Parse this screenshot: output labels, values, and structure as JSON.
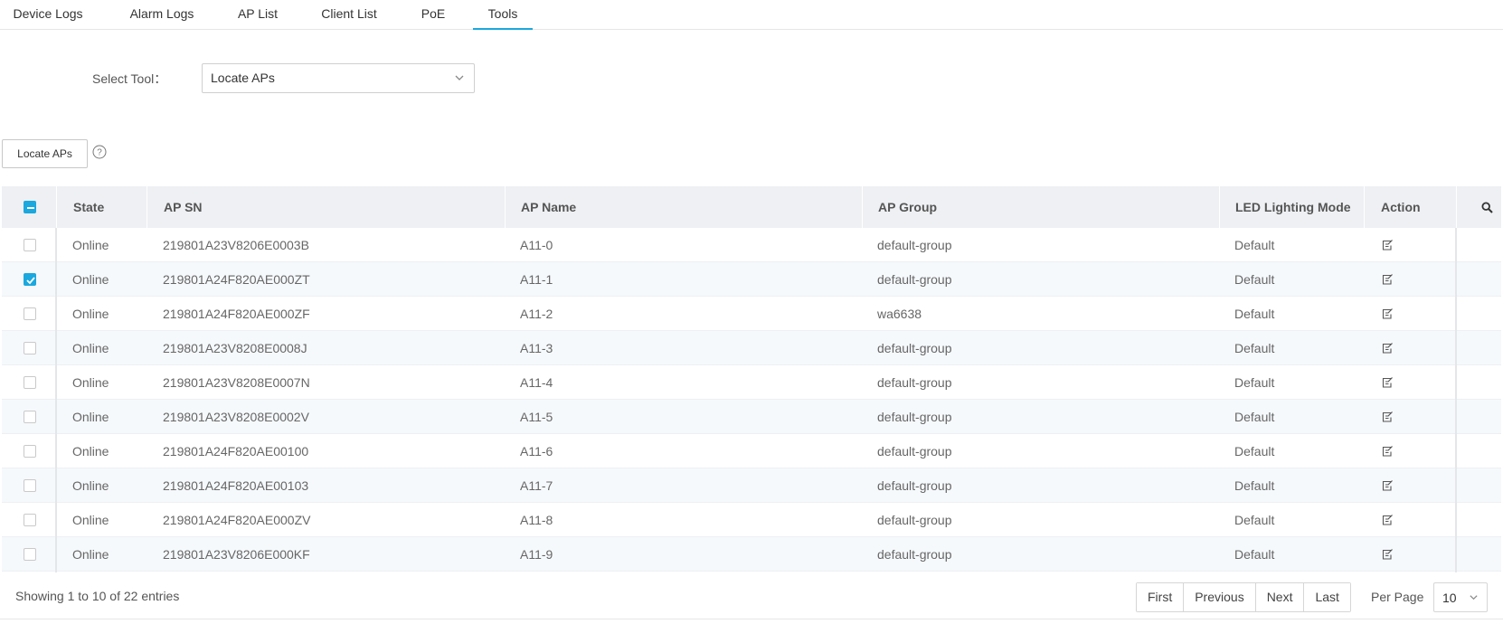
{
  "tabs": [
    {
      "label": "Device Logs",
      "active": false
    },
    {
      "label": "Alarm Logs",
      "active": false
    },
    {
      "label": "AP List",
      "active": false
    },
    {
      "label": "Client List",
      "active": false
    },
    {
      "label": "PoE",
      "active": false
    },
    {
      "label": "Tools",
      "active": true
    }
  ],
  "tool_select": {
    "label": "Select Tool：",
    "value": "Locate APs"
  },
  "locate_button": {
    "label": "Locate APs",
    "help_icon": "question-circle-icon"
  },
  "table": {
    "headers": {
      "state": "State",
      "ap_sn": "AP SN",
      "ap_name": "AP Name",
      "ap_group": "AP Group",
      "led_mode": "LED Lighting Mode",
      "action": "Action"
    },
    "header_checkbox": "partial",
    "rows": [
      {
        "checked": false,
        "state": "Online",
        "ap_sn": "219801A23V8206E0003B",
        "ap_name": "A11-0",
        "ap_group": "default-group",
        "led_mode": "Default"
      },
      {
        "checked": true,
        "state": "Online",
        "ap_sn": "219801A24F820AE000ZT",
        "ap_name": "A11-1",
        "ap_group": "default-group",
        "led_mode": "Default"
      },
      {
        "checked": false,
        "state": "Online",
        "ap_sn": "219801A24F820AE000ZF",
        "ap_name": "A11-2",
        "ap_group": "wa6638",
        "led_mode": "Default"
      },
      {
        "checked": false,
        "state": "Online",
        "ap_sn": "219801A23V8208E0008J",
        "ap_name": "A11-3",
        "ap_group": "default-group",
        "led_mode": "Default"
      },
      {
        "checked": false,
        "state": "Online",
        "ap_sn": "219801A23V8208E0007N",
        "ap_name": "A11-4",
        "ap_group": "default-group",
        "led_mode": "Default"
      },
      {
        "checked": false,
        "state": "Online",
        "ap_sn": "219801A23V8208E0002V",
        "ap_name": "A11-5",
        "ap_group": "default-group",
        "led_mode": "Default"
      },
      {
        "checked": false,
        "state": "Online",
        "ap_sn": "219801A24F820AE00100",
        "ap_name": "A11-6",
        "ap_group": "default-group",
        "led_mode": "Default"
      },
      {
        "checked": false,
        "state": "Online",
        "ap_sn": "219801A24F820AE00103",
        "ap_name": "A11-7",
        "ap_group": "default-group",
        "led_mode": "Default"
      },
      {
        "checked": false,
        "state": "Online",
        "ap_sn": "219801A24F820AE000ZV",
        "ap_name": "A11-8",
        "ap_group": "default-group",
        "led_mode": "Default"
      },
      {
        "checked": false,
        "state": "Online",
        "ap_sn": "219801A23V8206E000KF",
        "ap_name": "A11-9",
        "ap_group": "default-group",
        "led_mode": "Default"
      }
    ]
  },
  "footer": {
    "summary": "Showing 1 to 10 of 22 entries",
    "pager": {
      "first": "First",
      "previous": "Previous",
      "next": "Next",
      "last": "Last"
    },
    "per_page_label": "Per Page",
    "per_page_value": "10"
  },
  "colors": {
    "accent": "#1aa8de",
    "header_bg": "#eef0f3",
    "stripe": "#f6f9fc"
  }
}
